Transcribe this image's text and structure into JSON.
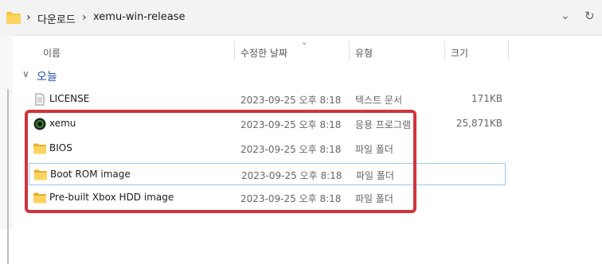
{
  "address": {
    "crumbs": [
      "다운로드",
      "xemu-win-release"
    ],
    "separator": "›"
  },
  "columns": {
    "name": "이름",
    "modified": "수정한 날짜",
    "type": "유형",
    "size": "크기"
  },
  "group": {
    "label": "오늘"
  },
  "files": [
    {
      "name": "LICENSE",
      "modified": "2023-09-25 오후 8:18",
      "type": "텍스트 문서",
      "size": "171KB",
      "icon": "text-document-icon"
    },
    {
      "name": "xemu",
      "modified": "2023-09-25 오후 8:18",
      "type": "응용 프로그램",
      "size": "25,871KB",
      "icon": "xemu-app-icon"
    },
    {
      "name": "BIOS",
      "modified": "2023-09-25 오후 8:18",
      "type": "파일 폴더",
      "size": "",
      "icon": "folder-icon"
    },
    {
      "name": "Boot ROM image",
      "modified": "2023-09-25 오후 8:18",
      "type": "파일 폴더",
      "size": "",
      "icon": "folder-icon"
    },
    {
      "name": "Pre-built Xbox HDD image",
      "modified": "2023-09-25 오후 8:18",
      "type": "파일 폴더",
      "size": "",
      "icon": "folder-icon"
    }
  ],
  "colors": {
    "highlight": "#d2333d",
    "folder": "#f8c640",
    "selection_border": "#99c9f0",
    "group_text": "#1f4fa8"
  }
}
